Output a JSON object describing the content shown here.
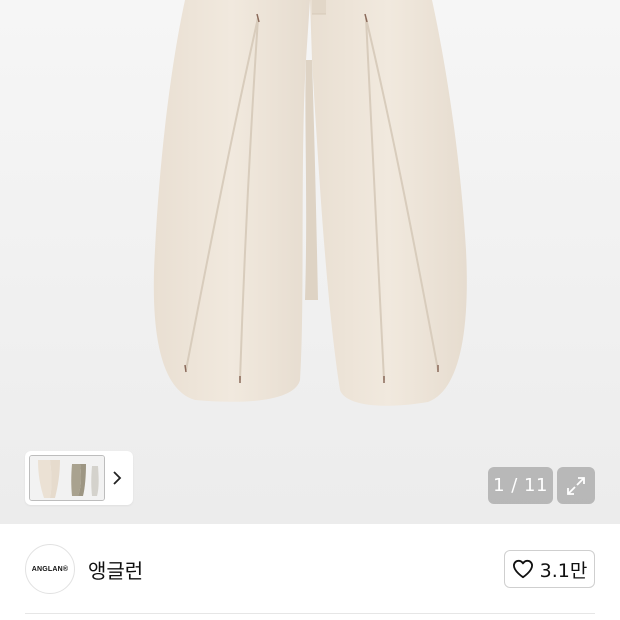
{
  "gallery": {
    "image_alt_icon": "cream-balloon-pants-image",
    "current": "1",
    "total": "11",
    "counter_text": "1 / 11",
    "thumb_next_icon": "chevron-right-icon",
    "expand_icon": "expand-arrows-icon"
  },
  "brand": {
    "logo_text": "ANGLAN®",
    "name": "앵글런"
  },
  "like": {
    "icon": "heart-outline-icon",
    "count": "3.1만"
  },
  "colors": {
    "pants": "#efe6da",
    "counter_bg": "#8f8f8f",
    "divider": "#e6e6e6"
  }
}
